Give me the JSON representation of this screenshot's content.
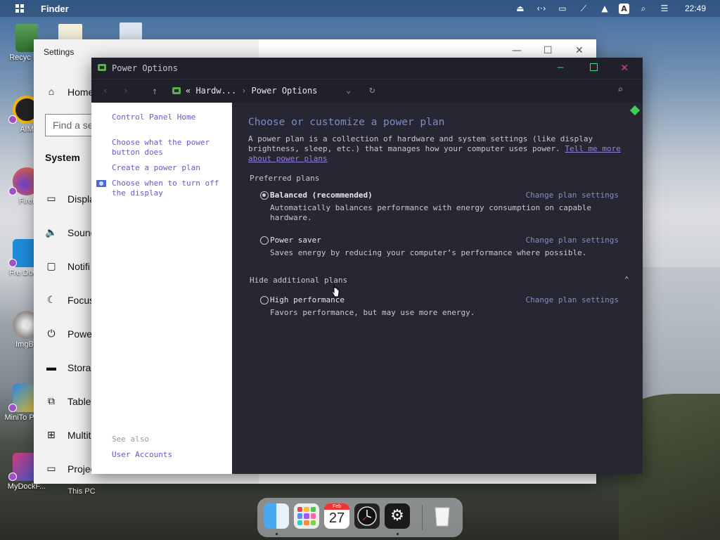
{
  "topbar": {
    "app_name": "Finder",
    "time": "22:49",
    "keyboard_indicator": "A"
  },
  "desktop_icons": [
    {
      "label": "Recyc Bin",
      "icon": "recycle-bin-icon"
    },
    {
      "label": "AIM",
      "icon": "aimp-icon"
    },
    {
      "label": "Firef",
      "icon": "firefox-icon"
    },
    {
      "label": "Fre Downl",
      "icon": "download-icon"
    },
    {
      "label": "ImgBu",
      "icon": "imgburn-icon"
    },
    {
      "label": "MiniTo Partiti",
      "icon": "minitool-icon"
    },
    {
      "label": "MyDockF...",
      "icon": "mydock-icon"
    },
    {
      "label": "This PC",
      "icon": "this-pc-icon"
    }
  ],
  "settings_window": {
    "title": "Settings",
    "home_label": "Home",
    "search_placeholder": "Find a se",
    "section_heading": "System",
    "nav_items": [
      {
        "label": "Displa",
        "icon": "display-icon"
      },
      {
        "label": "Sound",
        "icon": "sound-icon"
      },
      {
        "label": "Notifi",
        "icon": "notification-icon"
      },
      {
        "label": "Focus",
        "icon": "focus-icon"
      },
      {
        "label": "Power",
        "icon": "power-icon"
      },
      {
        "label": "Storag",
        "icon": "storage-icon"
      },
      {
        "label": "Tablet",
        "icon": "tablet-icon"
      },
      {
        "label": "Multit",
        "icon": "multitasking-icon"
      },
      {
        "label": "Projec",
        "icon": "projecting-icon"
      }
    ]
  },
  "power_window": {
    "title": "Power Options",
    "breadcrumb": {
      "parent": "« Hardw...",
      "separator": "›",
      "current": "Power Options"
    },
    "sidebar": {
      "home_link": "Control Panel Home",
      "links": [
        "Choose what the power button does",
        "Create a power plan",
        "Choose when to turn off the display"
      ],
      "see_also": "See also",
      "see_also_links": [
        "User Accounts"
      ]
    },
    "main": {
      "heading": "Choose or customize a power plan",
      "intro": "A power plan is a collection of hardware and system settings (like display brightness, sleep, etc.) that manages how your computer uses power.",
      "intro_link": "Tell me more about power plans",
      "preferred_heading": "Preferred plans",
      "plans": [
        {
          "name": "Balanced (recommended)",
          "selected": true,
          "change_label": "Change plan settings",
          "description": "Automatically balances performance with energy consumption on capable hardware."
        },
        {
          "name": "Power saver",
          "selected": false,
          "change_label": "Change plan settings",
          "description": "Saves energy by reducing your computer’s performance where possible."
        }
      ],
      "additional_heading": "Hide additional plans",
      "additional_plans": [
        {
          "name": "High performance",
          "selected": false,
          "change_label": "Change plan settings",
          "description": "Favors performance, but may use more energy."
        }
      ]
    }
  },
  "dock": {
    "items": [
      "finder-icon",
      "launchpad-icon",
      "calendar-icon",
      "clock-icon",
      "settings-icon",
      "trash-icon"
    ],
    "calendar_month": "Feb",
    "calendar_day": "27"
  }
}
